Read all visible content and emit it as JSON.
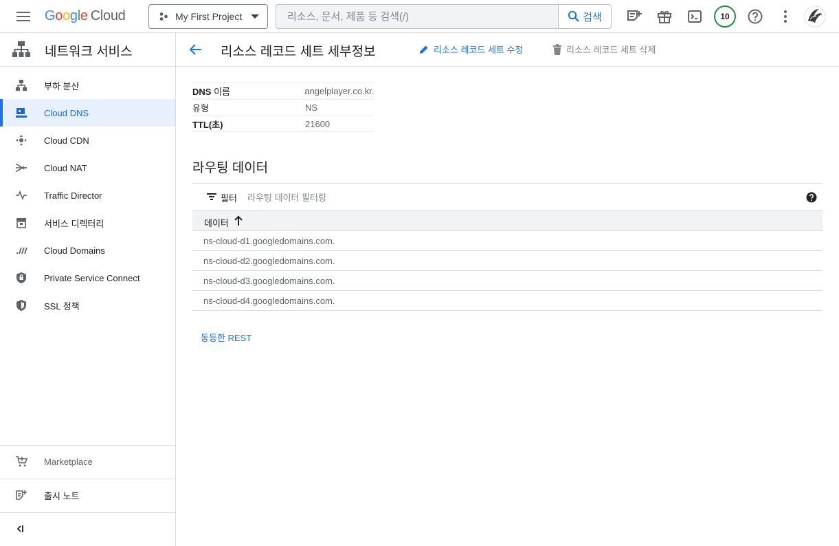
{
  "topbar": {
    "logo_google": [
      "G",
      "o",
      "o",
      "g",
      "l",
      "e"
    ],
    "logo_cloud": "Cloud",
    "project_name": "My First Project",
    "search_placeholder": "리소스, 문서, 제품 등 검색(/)",
    "search_button": "검색",
    "notification_count": "10",
    "icons": [
      "menu-icon",
      "project-icon",
      "dropdown-icon",
      "search-icon",
      "notes-icon",
      "gift-icon",
      "terminal-icon",
      "help-icon",
      "more-vert-icon"
    ]
  },
  "sidebar": {
    "title": "네트워크 서비스",
    "items": [
      {
        "label": "부하 분산",
        "icon": "load-balancing-icon"
      },
      {
        "label": "Cloud DNS",
        "icon": "dns-icon",
        "active": true
      },
      {
        "label": "Cloud CDN",
        "icon": "cdn-icon"
      },
      {
        "label": "Cloud NAT",
        "icon": "nat-icon"
      },
      {
        "label": "Traffic Director",
        "icon": "traffic-director-icon"
      },
      {
        "label": "서비스 디렉터리",
        "icon": "service-directory-icon"
      },
      {
        "label": "Cloud Domains",
        "icon": "domains-icon"
      },
      {
        "label": "Private Service Connect",
        "icon": "private-service-connect-icon"
      },
      {
        "label": "SSL 정책",
        "icon": "ssl-policy-icon"
      }
    ],
    "bottom": {
      "marketplace": "Marketplace",
      "release_notes": "출시 노트"
    }
  },
  "main": {
    "page_title": "리소스 레코드 세트 세부정보",
    "edit_label": "리소스 레코드 세트 수정",
    "delete_label": "리소스 레코드 세트 삭제",
    "properties": [
      {
        "key_bold": "DNS",
        "key_rest": " 이름",
        "value": "angelplayer.co.kr."
      },
      {
        "key_bold": "",
        "key_rest": "유형",
        "value": "NS"
      },
      {
        "key_bold": "TTL(초)",
        "key_rest": "",
        "value": "21600"
      }
    ],
    "routing_title": "라우팅 데이터",
    "filter_label": "필터",
    "filter_placeholder": "라우팅 데이터 필터링",
    "column_header": "데이터",
    "rows": [
      "ns-cloud-d1.googledomains.com.",
      "ns-cloud-d2.googledomains.com.",
      "ns-cloud-d3.googledomains.com.",
      "ns-cloud-d4.googledomains.com."
    ],
    "rest_link": "동등한 REST"
  },
  "colors": {
    "accent": "#1a73e8",
    "active_bg": "#e8f0fe",
    "badge_ring": "#1e8e3e"
  }
}
